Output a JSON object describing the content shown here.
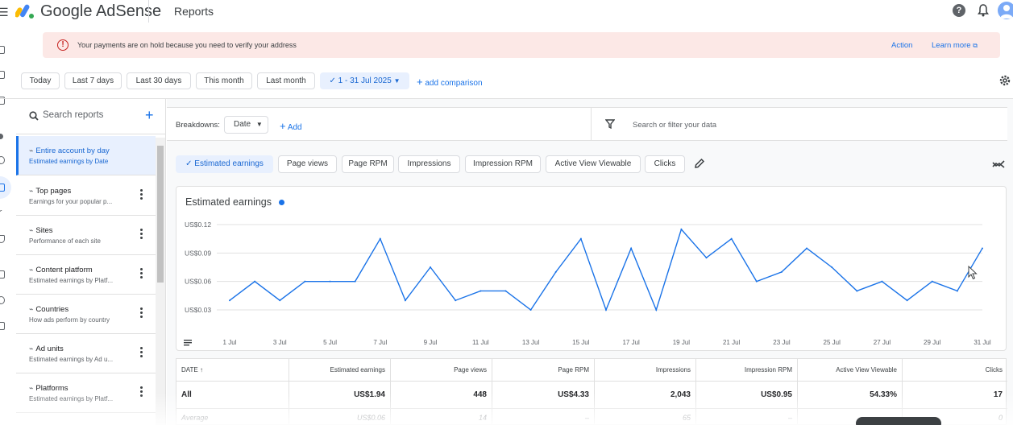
{
  "app": {
    "brand": "Google AdSense",
    "page": "Reports"
  },
  "colors": {
    "accent": "#1a73e8",
    "banner_bg": "#fce8e6",
    "error": "#c5221f"
  },
  "banner": {
    "icon": "error-icon",
    "message": "Your payments are on hold because you need to verify your address",
    "action": "Action",
    "learn_more": "Learn more"
  },
  "date_filters": {
    "presets": [
      "Today",
      "Last 7 days",
      "Last 30 days",
      "This month",
      "Last month"
    ],
    "selected_range": "1 - 31 Jul 2025",
    "add_comparison": "add comparison"
  },
  "sidebar": {
    "search_placeholder": "Search reports",
    "reports": [
      {
        "title": "Entire account by day",
        "subtitle": "Estimated earnings by Date"
      },
      {
        "title": "Top pages",
        "subtitle": "Earnings for your popular p..."
      },
      {
        "title": "Sites",
        "subtitle": "Performance of each site"
      },
      {
        "title": "Content platform",
        "subtitle": "Estimated earnings by Platf..."
      },
      {
        "title": "Countries",
        "subtitle": "How ads perform by country"
      },
      {
        "title": "Ad units",
        "subtitle": "Estimated earnings by Ad u..."
      },
      {
        "title": "Platforms",
        "subtitle": "Estimated earnings by Platf..."
      }
    ]
  },
  "breakdowns": {
    "label": "Breakdowns:",
    "value": "Date",
    "add": "Add",
    "filter_placeholder": "Search or filter your data"
  },
  "metrics": {
    "chips": [
      "Estimated earnings",
      "Page views",
      "Page RPM",
      "Impressions",
      "Impression RPM",
      "Active View Viewable",
      "Clicks"
    ],
    "selected": "Estimated earnings"
  },
  "chart_data": {
    "type": "line",
    "title": "Estimated earnings",
    "y_tick_labels": [
      "US$0.12",
      "US$0.09",
      "US$0.06",
      "US$0.03"
    ],
    "ylim": [
      0.03,
      0.12
    ],
    "x_tick_labels": [
      "1 Jul",
      "3 Jul",
      "5 Jul",
      "7 Jul",
      "9 Jul",
      "11 Jul",
      "13 Jul",
      "15 Jul",
      "17 Jul",
      "19 Jul",
      "21 Jul",
      "23 Jul",
      "25 Jul",
      "27 Jul",
      "29 Jul",
      "31 Jul"
    ],
    "grid": true,
    "series": [
      {
        "x": [
          1,
          2,
          3,
          4,
          5,
          6,
          7,
          8,
          9,
          10,
          11,
          12,
          13,
          14,
          15,
          16,
          17,
          18,
          19,
          20,
          21,
          22,
          23,
          24,
          25,
          26,
          27,
          28,
          29,
          30,
          31
        ],
        "values": [
          0.04,
          0.06,
          0.04,
          0.06,
          0.06,
          0.06,
          0.105,
          0.04,
          0.075,
          0.04,
          0.05,
          0.05,
          0.03,
          0.07,
          0.105,
          0.03,
          0.095,
          0.03,
          0.115,
          0.085,
          0.105,
          0.06,
          0.07,
          0.095,
          0.075,
          0.05,
          0.06,
          0.04,
          0.06,
          0.05,
          0.095
        ]
      }
    ]
  },
  "table": {
    "columns": [
      "DATE",
      "Estimated earnings",
      "Page views",
      "Page RPM",
      "Impressions",
      "Impression RPM",
      "Active View Viewable",
      "Clicks"
    ],
    "total_row": [
      "All",
      "US$1.94",
      "448",
      "US$4.33",
      "2,043",
      "US$0.95",
      "54.33%",
      "17"
    ],
    "average_row": [
      "Average",
      "US$0.06",
      "14",
      "–",
      "65",
      "–",
      "–",
      "0"
    ]
  }
}
